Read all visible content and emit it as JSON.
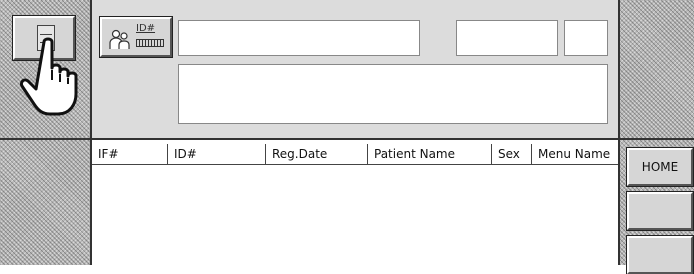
{
  "identity_button": {
    "label": "ID#"
  },
  "fields": {
    "field_1": "",
    "field_2": "",
    "field_3": "",
    "field_4": ""
  },
  "table": {
    "columns": [
      "IF#",
      "ID#",
      "Reg.Date",
      "Patient Name",
      "Sex",
      "Menu Name"
    ],
    "rows": []
  },
  "side_buttons": {
    "home": "HOME",
    "button_2": "",
    "button_3": ""
  },
  "icons": {
    "menu": "menu-icon",
    "pointer": "hand-pointer-icon",
    "people": "people-icon"
  }
}
